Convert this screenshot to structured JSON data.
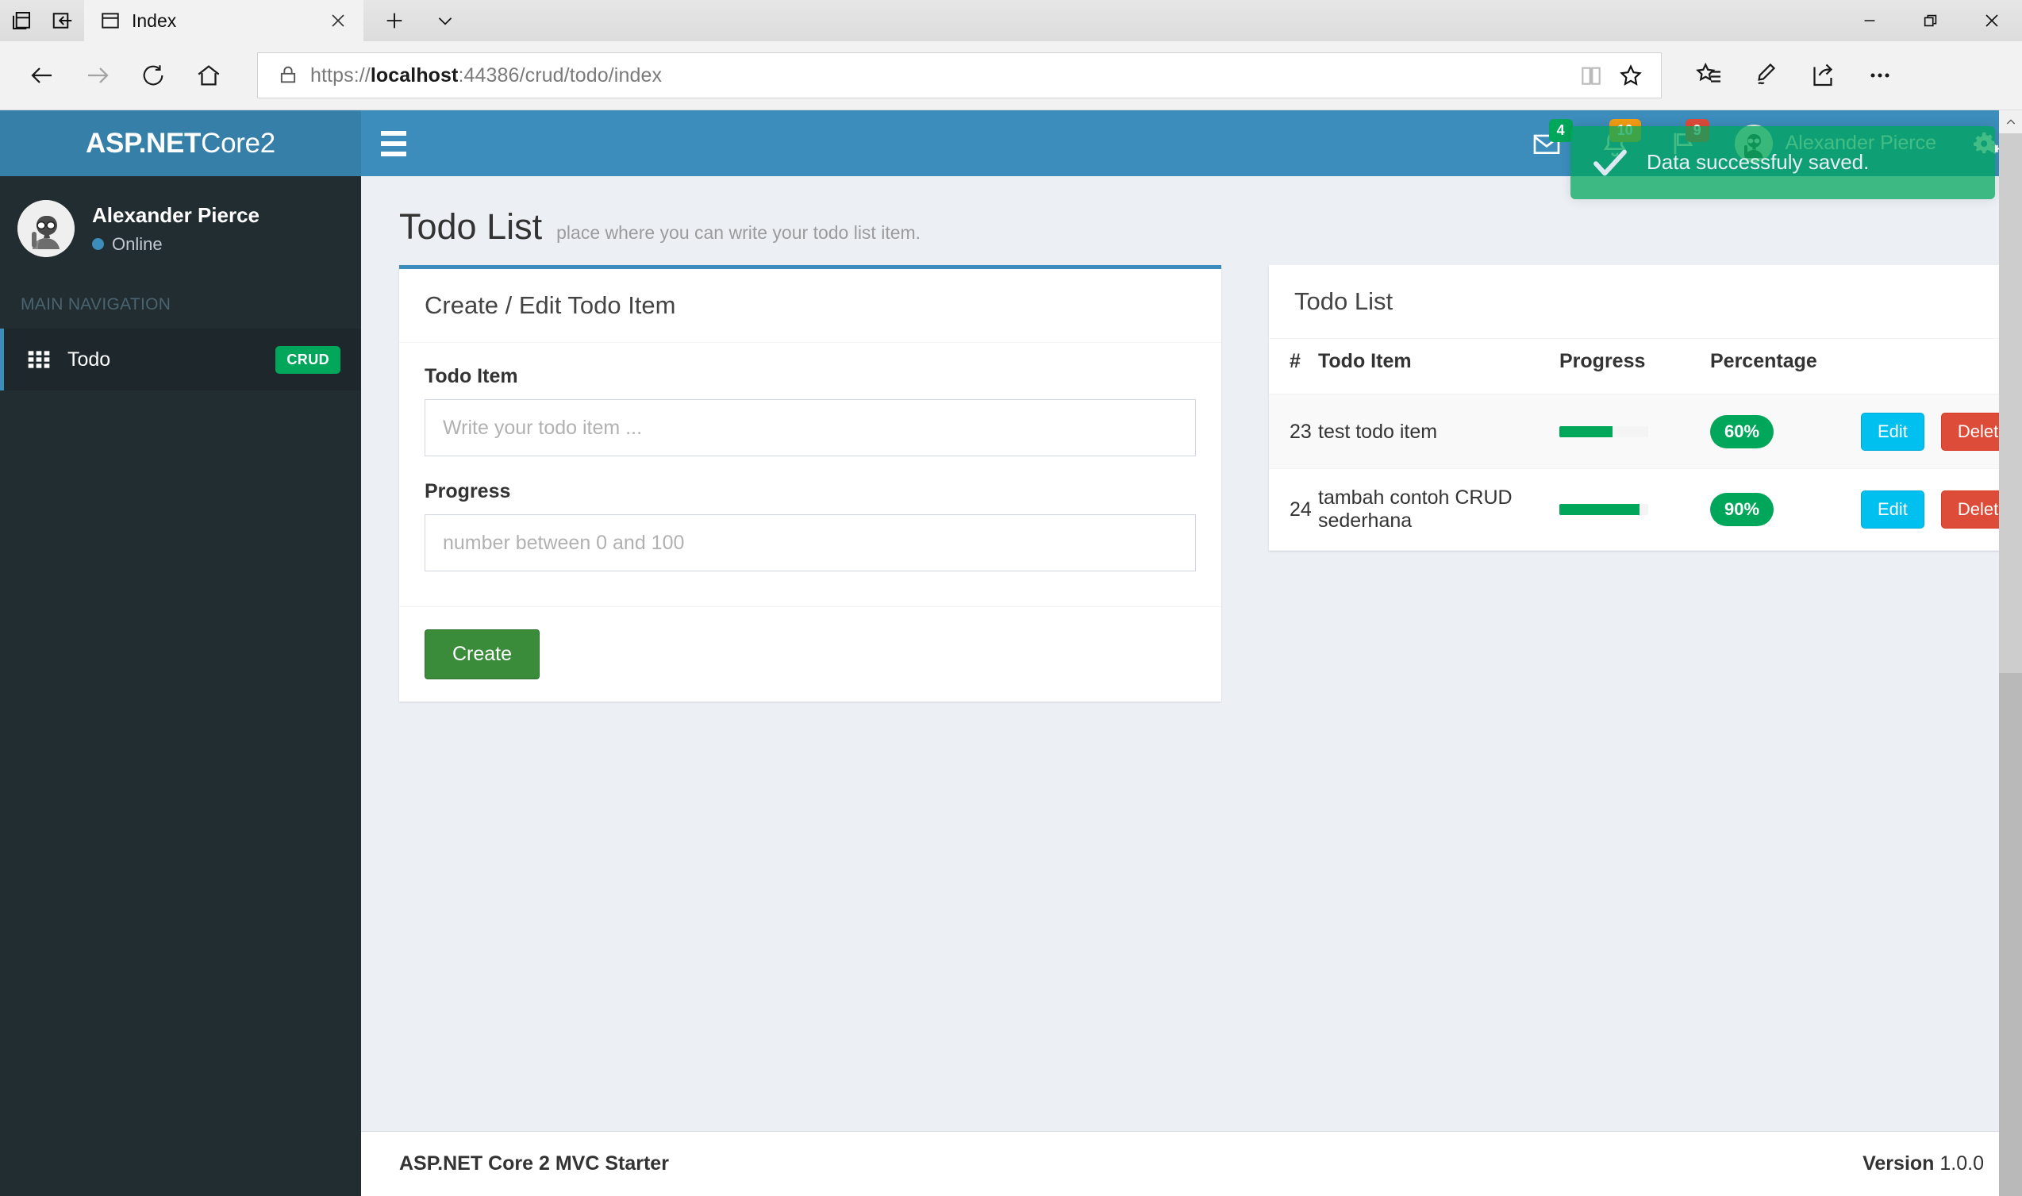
{
  "browser": {
    "tab_title": "Index",
    "url_prefix": "https://",
    "url_host": "localhost",
    "url_rest": ":44386/crud/todo/index",
    "icons": {
      "tab_preview": "tab-preview-icon",
      "set_aside": "set-tabs-aside-icon",
      "tab_favicon": "page-icon",
      "tab_close": "close-icon",
      "new_tab": "plus-icon",
      "tab_menu": "chevron-down-icon",
      "back": "back-arrow-icon",
      "forward": "forward-arrow-icon",
      "refresh": "refresh-icon",
      "home": "home-icon",
      "lock": "lock-icon",
      "reading_view": "book-icon",
      "favorite": "star-icon",
      "hub": "hub-star-list-icon",
      "web_note": "pen-icon",
      "share": "share-icon",
      "more": "ellipsis-icon",
      "minimize": "minimize-icon",
      "restore": "restore-icon",
      "close_window": "close-window-icon"
    }
  },
  "sidebar": {
    "logo_bold": "ASP.NET",
    "logo_light": "Core2",
    "user": {
      "name": "Alexander Pierce",
      "status": "Online"
    },
    "nav_header": "MAIN NAVIGATION",
    "items": [
      {
        "label": "Todo",
        "badge": "CRUD",
        "icon": "th-grid-icon"
      }
    ]
  },
  "navbar": {
    "toggle_icon": "hamburger-icon",
    "notifications": [
      {
        "icon": "envelope-icon",
        "count": "4",
        "color": "green"
      },
      {
        "icon": "bell-icon",
        "count": "10",
        "color": "yellow"
      },
      {
        "icon": "flag-icon",
        "count": "9",
        "color": "red"
      }
    ],
    "user_name": "Alexander Pierce",
    "settings_icon": "gears-icon"
  },
  "toast": {
    "icon": "check-icon",
    "message": "Data successfuly saved."
  },
  "page": {
    "title": "Todo List",
    "subtitle": "place where you can write your todo list item."
  },
  "form_box": {
    "title": "Create / Edit Todo Item",
    "fields": [
      {
        "label": "Todo Item",
        "placeholder": "Write your todo item ...",
        "value": ""
      },
      {
        "label": "Progress",
        "placeholder": "number between 0 and 100",
        "value": ""
      }
    ],
    "submit_label": "Create"
  },
  "list_box": {
    "title": "Todo List",
    "columns": [
      "#",
      "Todo Item",
      "Progress",
      "Percentage",
      ""
    ],
    "rows": [
      {
        "num": "23",
        "item": "test todo item",
        "progress": 60,
        "percentage": "60%",
        "edit_label": "Edit",
        "delete_label": "Delete"
      },
      {
        "num": "24",
        "item": "tambah contoh CRUD sederhana",
        "progress": 90,
        "percentage": "90%",
        "edit_label": "Edit",
        "delete_label": "Delete"
      }
    ]
  },
  "footer": {
    "left": "ASP.NET Core 2 MVC Starter",
    "version_label": "Version",
    "version_number": "1.0.0"
  },
  "colors": {
    "brand_blue": "#3c8dbc",
    "logo_blue": "#367fa9",
    "sidebar_dark": "#222d32",
    "success_green": "#00a65a",
    "create_green": "#3a8c3b",
    "info_cyan": "#00c0ef",
    "danger_red": "#dd4b39",
    "warning_yellow": "#f39c12",
    "content_bg": "#ecf0f5"
  }
}
